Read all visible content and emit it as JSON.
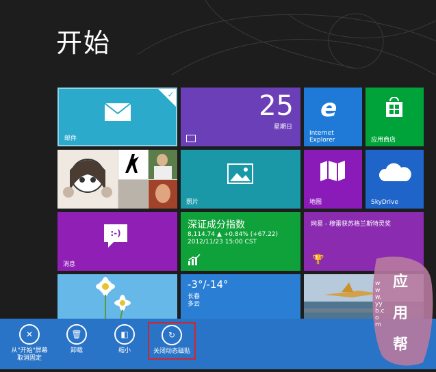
{
  "start": {
    "title": "开始"
  },
  "tiles": {
    "mail": {
      "label": "邮件"
    },
    "calendar": {
      "day": "25",
      "weekday": "星期日"
    },
    "ie": {
      "label": "Internet\nExplorer"
    },
    "store": {
      "label": "应用商店"
    },
    "photos": {
      "label": "照片"
    },
    "maps": {
      "label": "地图"
    },
    "skydrive": {
      "label": "SkyDrive"
    },
    "messaging": {
      "label": "消息"
    },
    "finance": {
      "name": "深证成分指数",
      "line1": "8,114.74 ▲ +0.84% (+67.22)",
      "line2": "2012/11/23 15:00 CST"
    },
    "news": {
      "headline": "网易 - 穆雷获苏格兰斯特灵奖"
    },
    "weather": {
      "temp": "-3°/-14°",
      "city": "长春",
      "cond": "多云"
    }
  },
  "appbar": {
    "unpin": "从\"开始\"屏幕\n取消固定",
    "uninstall": "卸载",
    "smaller": "缩小",
    "live_off": "关闭动态磁贴"
  },
  "watermark": {
    "text": "应用帮",
    "url": "www.yyb.com"
  },
  "colors": {
    "bg": "#1d1d1d",
    "appbar": "#2a74c7",
    "mail": "#2baacb",
    "calendar": "#6b3fb8",
    "ie": "#1e7ad6",
    "store": "#00a33a",
    "photos": "#1b98a8",
    "maps": "#8b1bb8",
    "skydrive": "#1f64c9",
    "messaging": "#8f1fb5",
    "finance": "#10a23a",
    "weather": "#2a7fd4",
    "highlight": "#d3242a"
  }
}
